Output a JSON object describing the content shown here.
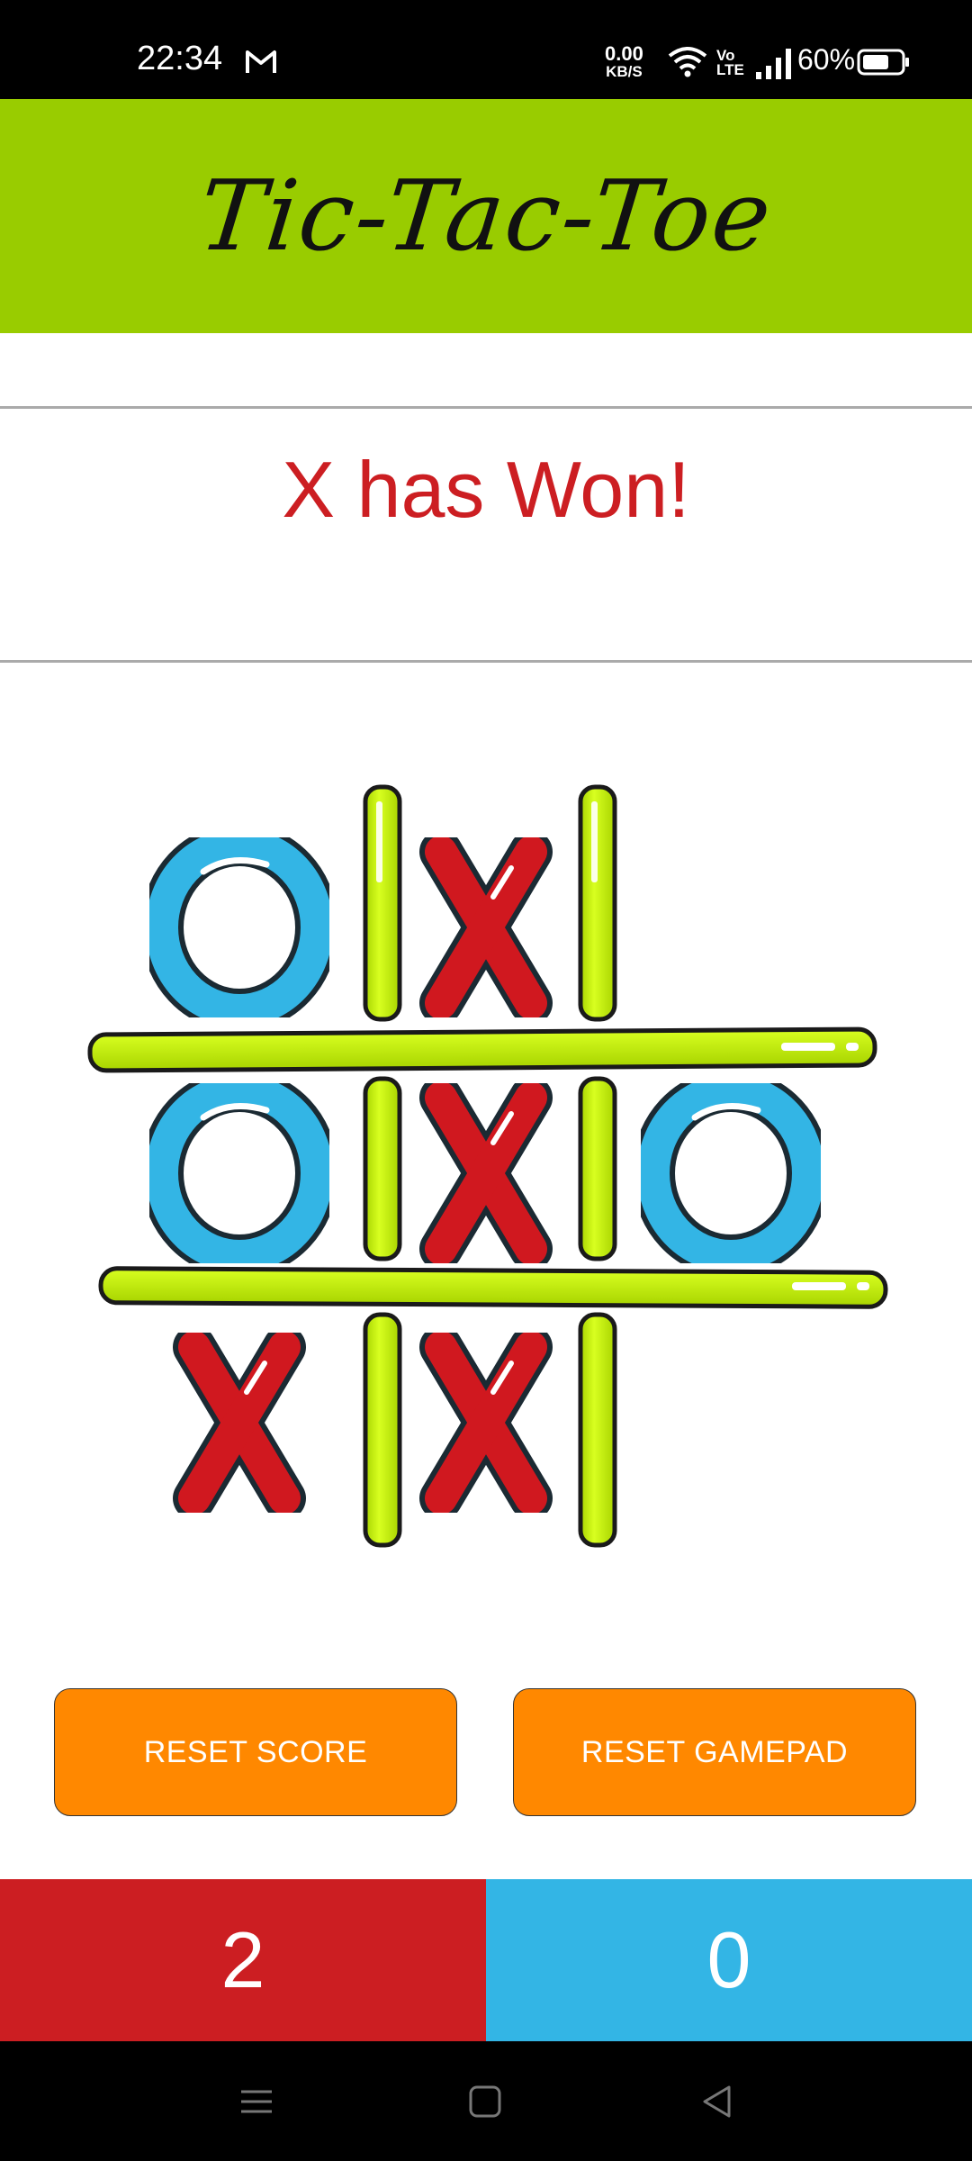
{
  "status_bar": {
    "time": "22:34",
    "net_speed_value": "0.00",
    "net_speed_unit": "KB/S",
    "volte": "Vo LTE",
    "battery": "60%",
    "icons": [
      "gmail-icon",
      "wifi-icon",
      "signal-icon",
      "battery-icon"
    ]
  },
  "header": {
    "title": "Tic-Tac-Toe"
  },
  "status": {
    "message": "X has Won!"
  },
  "board": {
    "cells": [
      "O",
      "X",
      "",
      "O",
      "X",
      "O",
      "X",
      "X",
      ""
    ]
  },
  "buttons": {
    "reset_score": "RESET SCORE",
    "reset_gamepad": "RESET GAMEPAD"
  },
  "score": {
    "x": "2",
    "o": "0"
  },
  "colors": {
    "header_bg": "#99cc00",
    "status_text": "#cc1e22",
    "x_color": "#d0181f",
    "o_color": "#33b5e5",
    "grid_color": "#c6f000",
    "button_bg": "#ff8800",
    "score_x_bg": "#cc1e22",
    "score_o_bg": "#33b5e5"
  },
  "nav_bar": {
    "icons": [
      "menu-icon",
      "home-icon",
      "back-icon"
    ]
  }
}
